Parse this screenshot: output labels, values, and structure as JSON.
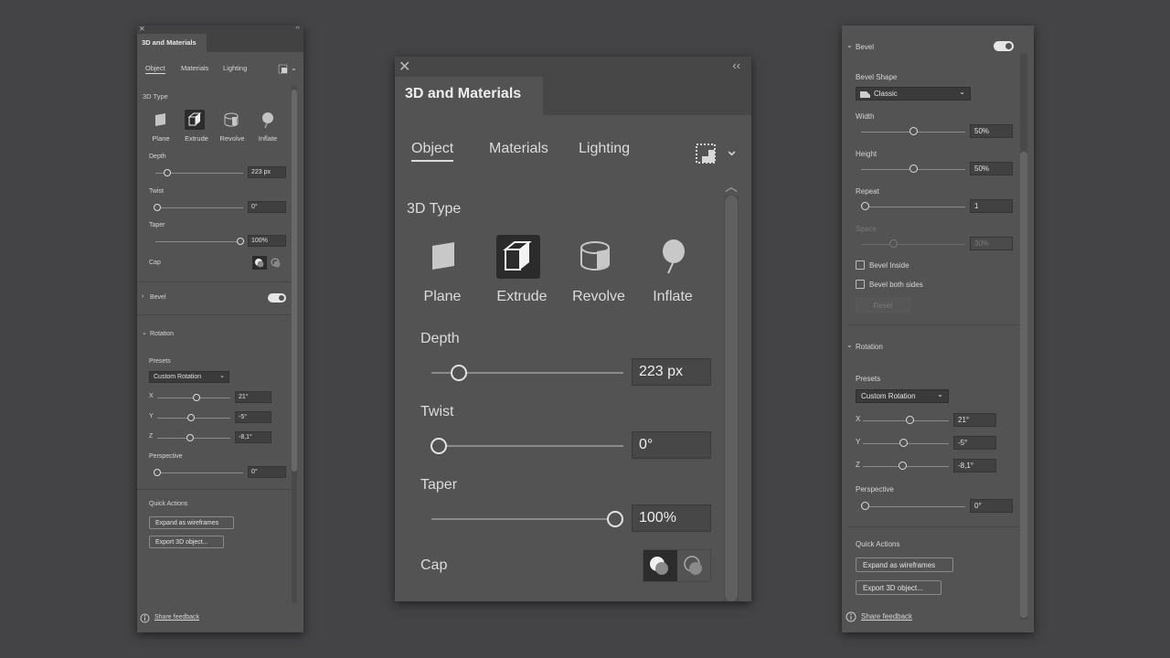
{
  "panel": {
    "title": "3D and Materials",
    "tabs": [
      "Object",
      "Materials",
      "Lighting"
    ],
    "active_tab": "Object",
    "close_glyph": "✕",
    "collapse_glyph": "‹‹"
  },
  "type_section": {
    "title": "3D Type",
    "types": [
      {
        "label": "Plane",
        "icon": "plane-icon"
      },
      {
        "label": "Extrude",
        "icon": "extrude-icon",
        "selected": true
      },
      {
        "label": "Revolve",
        "icon": "revolve-icon"
      },
      {
        "label": "Inflate",
        "icon": "inflate-icon"
      }
    ]
  },
  "depth": {
    "label": "Depth",
    "value": "223 px",
    "level": 0.1
  },
  "twist": {
    "label": "Twist",
    "value": "0°",
    "level": 0
  },
  "taper": {
    "label": "Taper",
    "value": "100%",
    "level": 1
  },
  "cap": {
    "label": "Cap"
  },
  "bevel": {
    "title": "Bevel",
    "enabled": true,
    "shape_label": "Bevel Shape",
    "shape_value": "Classic",
    "width": {
      "label": "Width",
      "value": "50%"
    },
    "height": {
      "label": "Height",
      "value": "50%"
    },
    "repeat": {
      "label": "Repeat",
      "value": "1"
    },
    "space": {
      "label": "Space",
      "value": "30%"
    },
    "inside_label": "Bevel Inside",
    "both_sides_label": "Bevel both sides",
    "reset_label": "Reset"
  },
  "rotation": {
    "title": "Rotation",
    "presets_label": "Presets",
    "preset_value": "Custom Rotation",
    "x": {
      "label": "X",
      "value": "21°"
    },
    "y": {
      "label": "Y",
      "value": "-5°"
    },
    "z": {
      "label": "Z",
      "value": "-8,1°"
    },
    "perspective": {
      "label": "Perspective",
      "value": "0°"
    }
  },
  "quick_actions": {
    "title": "Quick Actions",
    "expand_label": "Expand as wireframes",
    "export_label": "Export 3D object..."
  },
  "footer": {
    "feedback_label": "Share feedback"
  },
  "colors": {
    "background": "#444446",
    "panel": "#535353",
    "field": "#474747",
    "selected": "#2c2c2c"
  }
}
